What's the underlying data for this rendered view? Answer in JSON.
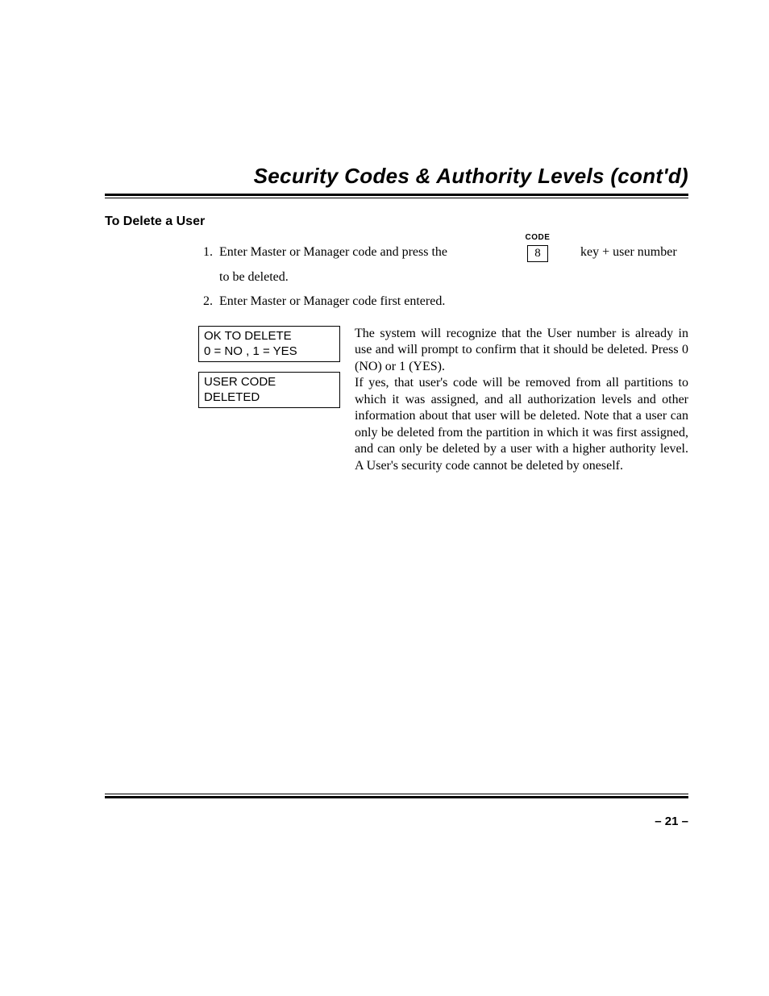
{
  "title": "Security Codes & Authority Levels (cont'd)",
  "subheading": "To Delete a User",
  "steps": {
    "s1": {
      "num": "1.",
      "text_a": "Enter Master or Manager code and press the",
      "code_label": "CODE",
      "key": "8",
      "suffix": "key + user number",
      "cont": "to be deleted."
    },
    "s2": {
      "num": "2.",
      "text": "Enter Master or Manager code first entered."
    }
  },
  "displays": {
    "d1": {
      "line1": "OK TO DELETE",
      "line2": "0 = NO , 1 = YES"
    },
    "d2": {
      "line1": "USER CODE",
      "line2": "DELETED"
    }
  },
  "explain": {
    "p1": "The system will recognize that the User number is already in use and will prompt to confirm that it should be deleted. Press 0 (NO) or 1 (YES).",
    "p2": "If yes, that user's code will be removed from all partitions to which it was assigned, and all authorization levels and other information about that user will be deleted. Note that a user can only be deleted from the partition in which it was first assigned, and can only be deleted by a user with a higher authority level. A User's security code cannot be deleted by oneself."
  },
  "page_number": "– 21 –"
}
